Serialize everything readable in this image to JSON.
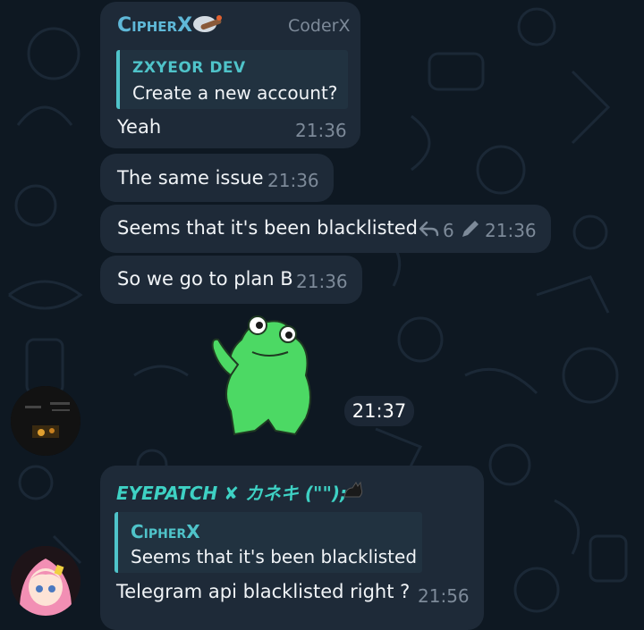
{
  "messages": [
    {
      "sender": "CipherX",
      "sender_title": "CoderX",
      "reply": {
        "author": "ZXYEOR DEV",
        "text": "Create a new account?"
      },
      "text": "Yeah",
      "time": "21:36"
    },
    {
      "text": "The same issue",
      "time": "21:36"
    },
    {
      "text": "Seems that it's been blacklisted",
      "replies": "6",
      "time": "21:36"
    },
    {
      "text": "So we go to plan B",
      "time": "21:36"
    },
    {
      "sticker": "frog-sticker",
      "time": "21:37"
    },
    {
      "sender": "EYEPATCH ✘ カネキ (\"\");",
      "reply": {
        "author": "CipherX",
        "text": "Seems that it's been blacklisted"
      },
      "text": "Telegram api blacklisted right ?",
      "time": "21:56"
    }
  ],
  "colors": {
    "background": "#0e1822",
    "bubble": "#1e2a38",
    "sender_cipherx": "#5fb8d8",
    "sender_eyepatch": "#3ed1c4",
    "accent": "#4fc3c9",
    "time": "#7d8a99",
    "sticker_frog": "#4cd964"
  },
  "icons": [
    "reply-arrow-icon",
    "edit-pencil-icon",
    "cat-emoji-icon",
    "cigar-emoji-icon"
  ]
}
